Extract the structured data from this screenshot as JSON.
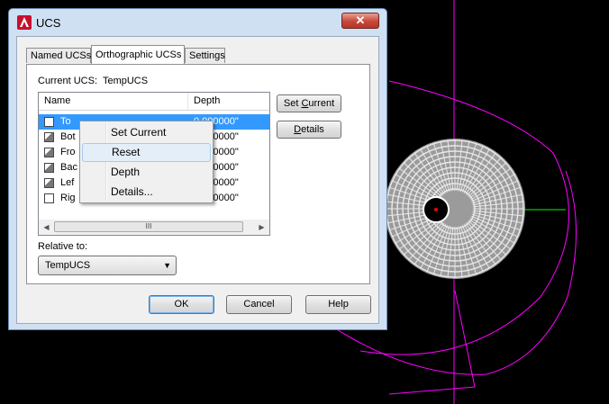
{
  "window": {
    "title": "UCS",
    "close_glyph": "✕"
  },
  "tabs": [
    {
      "label": "Named UCSs"
    },
    {
      "label": "Orthographic UCSs"
    },
    {
      "label": "Settings"
    }
  ],
  "current_ucs": {
    "label": "Current UCS:",
    "value": "TempUCS"
  },
  "list": {
    "columns": [
      "Name",
      "Depth"
    ],
    "rows": [
      {
        "name": "To",
        "depth": "0.000000\""
      },
      {
        "name": "Bot",
        "depth": "0.000000\""
      },
      {
        "name": "Fro",
        "depth": "0.000000\""
      },
      {
        "name": "Bac",
        "depth": "0.000000\""
      },
      {
        "name": "Lef",
        "depth": "0.000000\""
      },
      {
        "name": "Rig",
        "depth": "0.000000\""
      }
    ],
    "scroll_thumb_glyph": "III"
  },
  "side_buttons": {
    "set_current_pre": "Set ",
    "set_current_u": "C",
    "set_current_post": "urrent",
    "details_pre": "",
    "details_u": "D",
    "details_post": "etails"
  },
  "relative_to": {
    "label": "Relative to:",
    "value": "TempUCS"
  },
  "context_menu": {
    "items": [
      "Set Current",
      "Reset",
      "Depth",
      "Details..."
    ],
    "hover_index": 1
  },
  "buttons": {
    "ok": "OK",
    "cancel": "Cancel",
    "help": "Help"
  },
  "icons": {
    "app": "autocad-a-icon",
    "close": "close-icon"
  },
  "colors": {
    "selection": "#3399ff",
    "drawing_magenta": "#ff00ff",
    "drawing_green": "#00ff00"
  }
}
